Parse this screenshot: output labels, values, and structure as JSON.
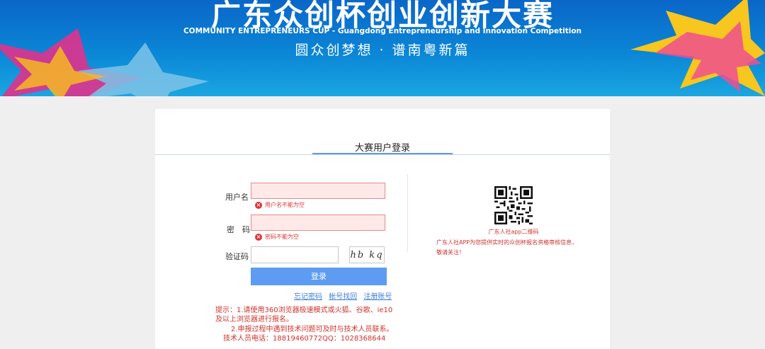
{
  "banner": {
    "title": "广东众创杯创业创新大赛",
    "subtitle_en": "COMMUNITY ENTREPRENEURS CUP - Guangdong Entrepreneurship and Innovation Competition",
    "subtitle_cn": "圆众创梦想 · 谱南粤新篇"
  },
  "login": {
    "title": "大赛用户登录",
    "username_label": "用户名",
    "username_value": "",
    "username_error": "用户名不能为空",
    "password_label": "密　码",
    "password_value": "",
    "password_error": "密码不能为空",
    "captcha_label": "验证码",
    "captcha_value": "",
    "captcha_text": "hb kq",
    "login_button": "登录",
    "links": {
      "forgot": "忘记密码",
      "recover": "帐号找回",
      "register": "注册账号"
    },
    "tips": {
      "line1": "提示：1.请使用360浏览器极速模式或火狐、谷歌、ie10",
      "line2": "及以上浏览器进行报名。",
      "line3": "2.申报过程中遇到技术问题可及时与技术人员联系。",
      "line4": "技术人员电话：18819460772QQ：1028368644"
    }
  },
  "qr": {
    "caption": "广东人社app二维码",
    "desc": "广东人社APP为您提供实时的众创杯报名资格审核信息，敬请关注！"
  },
  "colors": {
    "banner_blue": "#0b86d6",
    "error_red": "#d33333",
    "button_blue": "#5d9cf2",
    "link_blue": "#3f7fd8"
  }
}
